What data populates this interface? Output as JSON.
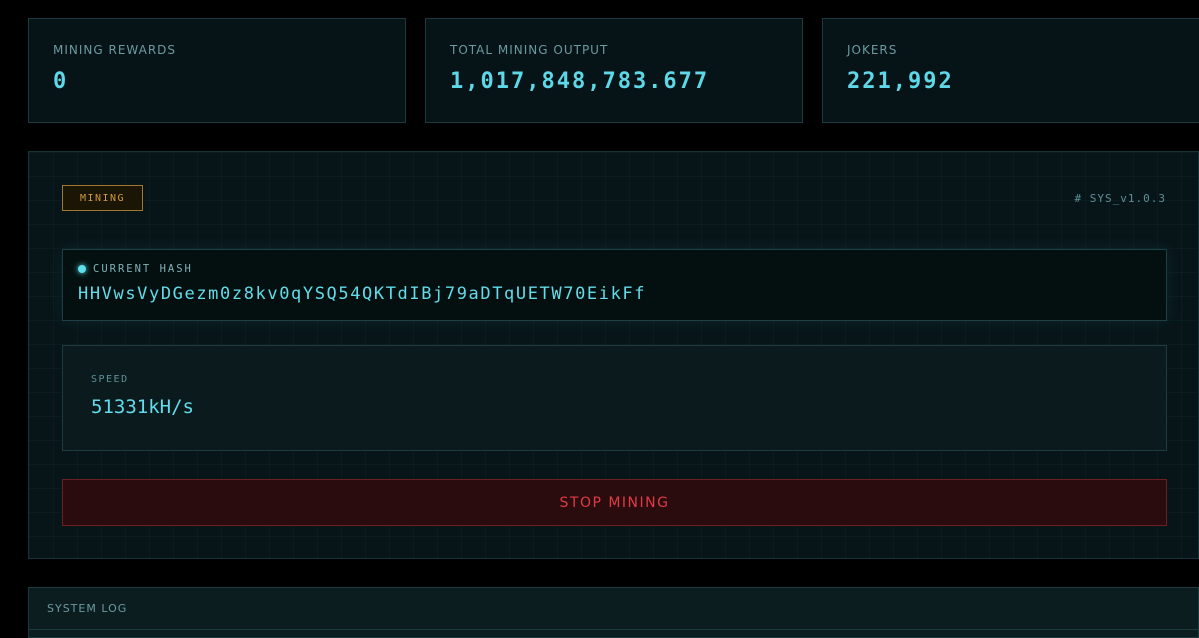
{
  "stats": [
    {
      "label": "MINING REWARDS",
      "value": "0"
    },
    {
      "label": "TOTAL MINING OUTPUT",
      "value": "1,017,848,783.677"
    },
    {
      "label": "JOKERS",
      "value": "221,992"
    }
  ],
  "mining": {
    "mode_label": "MINING",
    "version": "# SYS_v1.0.3",
    "hash_label": "CURRENT HASH",
    "hash_value": "HHVwsVyDGezm0z8kv0qYSQ54QKTdIBj79aDTqUETW70EikFf",
    "speed_label": "SPEED",
    "speed_value": "51331kH/s",
    "stop_label": "STOP MINING"
  },
  "log": {
    "title": "SYSTEM LOG"
  },
  "colors": {
    "accent": "#5ed8e6",
    "warning": "#d19a3c",
    "danger": "#e03a44"
  }
}
